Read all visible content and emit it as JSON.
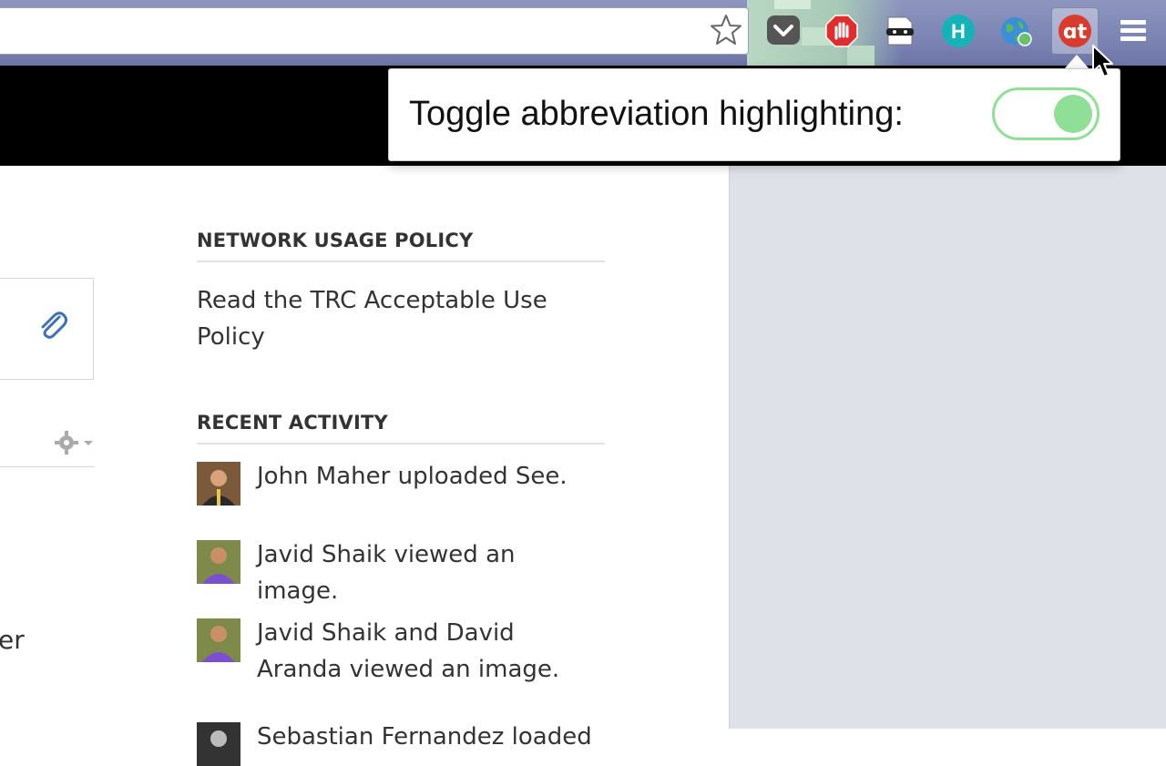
{
  "browser": {
    "extensions": [
      {
        "name": "pocket-icon"
      },
      {
        "name": "adblock-icon"
      },
      {
        "name": "incognito-mask-icon"
      },
      {
        "name": "hypothesis-icon",
        "letter": "H"
      },
      {
        "name": "globe-icon"
      },
      {
        "name": "abbreviation-highlighter-icon",
        "letter": "ɑt"
      },
      {
        "name": "menu-icon"
      }
    ]
  },
  "popup": {
    "label": "Toggle abbreviation highlighting:",
    "toggle_on": true,
    "accent_color": "#8fe096"
  },
  "left_fragment": "er",
  "network_policy": {
    "title": "NETWORK USAGE POLICY",
    "link": "Read the TRC Acceptable Use Policy"
  },
  "recent_activity": {
    "title": "RECENT ACTIVITY",
    "items": [
      {
        "text": "John Maher uploaded See."
      },
      {
        "text": "Javid Shaik viewed an image."
      },
      {
        "text": "Javid Shaik and David Aranda viewed an image."
      },
      {
        "text": "Sebastian Fernandez loaded"
      }
    ]
  }
}
